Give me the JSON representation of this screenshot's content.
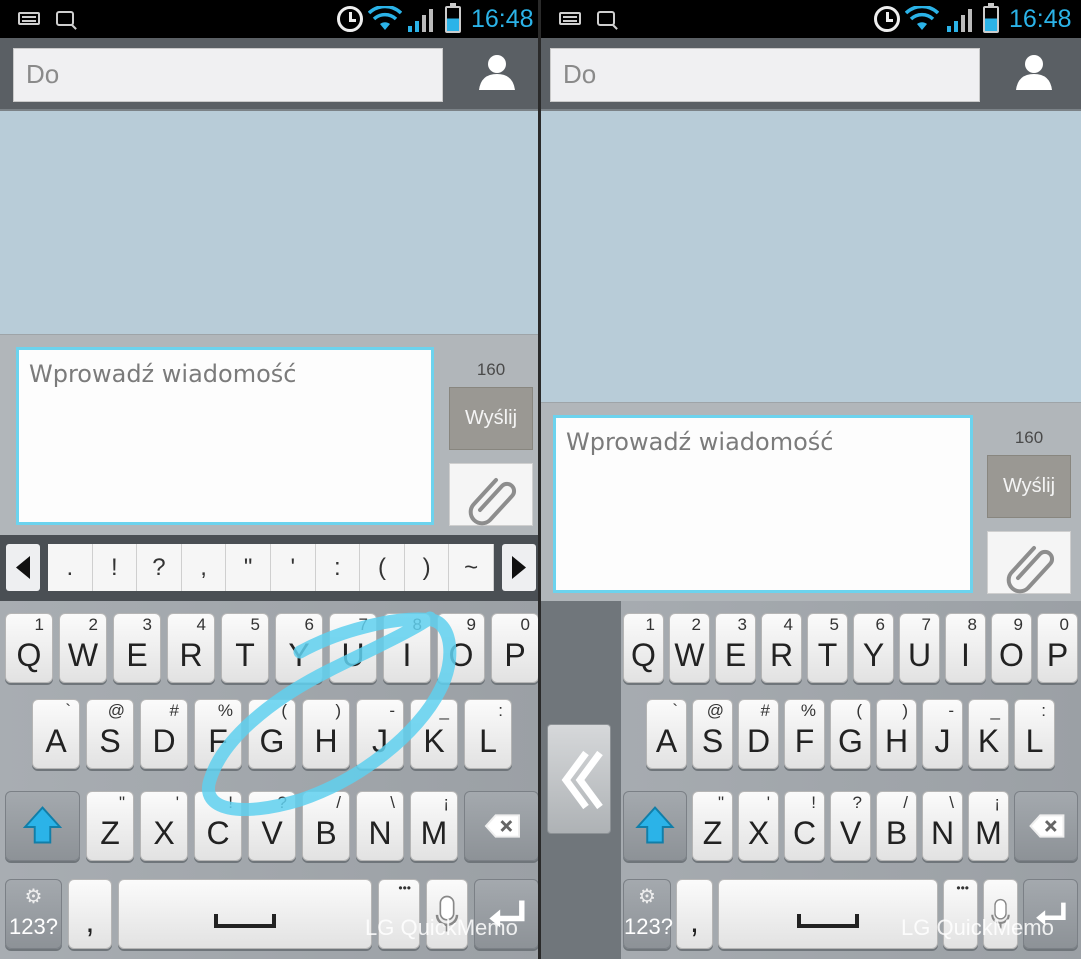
{
  "status_bar": {
    "time": "16:48"
  },
  "recipient": {
    "placeholder": "Do"
  },
  "compose": {
    "placeholder": "Wprowadź wiadomość",
    "counter": "160",
    "send_label": "Wyślij"
  },
  "suggestions": [
    ".",
    "!",
    "?",
    ",",
    "\"",
    "'",
    ":",
    "(",
    ")",
    "~"
  ],
  "keyboard": {
    "row1": [
      {
        "k": "Q",
        "s": "1"
      },
      {
        "k": "W",
        "s": "2"
      },
      {
        "k": "E",
        "s": "3"
      },
      {
        "k": "R",
        "s": "4"
      },
      {
        "k": "T",
        "s": "5"
      },
      {
        "k": "Y",
        "s": "6"
      },
      {
        "k": "U",
        "s": "7"
      },
      {
        "k": "I",
        "s": "8"
      },
      {
        "k": "O",
        "s": "9"
      },
      {
        "k": "P",
        "s": "0"
      }
    ],
    "row2": [
      {
        "k": "A",
        "s": "`"
      },
      {
        "k": "S",
        "s": "@"
      },
      {
        "k": "D",
        "s": "#"
      },
      {
        "k": "F",
        "s": "%"
      },
      {
        "k": "G",
        "s": "("
      },
      {
        "k": "H",
        "s": ")"
      },
      {
        "k": "J",
        "s": "-"
      },
      {
        "k": "K",
        "s": "_"
      },
      {
        "k": "L",
        "s": ":"
      }
    ],
    "row3": [
      {
        "k": "Z",
        "s": "\""
      },
      {
        "k": "X",
        "s": "'"
      },
      {
        "k": "C",
        "s": "!"
      },
      {
        "k": "V",
        "s": "?"
      },
      {
        "k": "B",
        "s": "/"
      },
      {
        "k": "N",
        "s": "\\"
      },
      {
        "k": "M",
        "s": "¡"
      }
    ],
    "symbols_label": "123?",
    "comma": ",",
    "dots_label": "•••"
  },
  "watermark": "LG QuickMemo",
  "colors": {
    "accent": "#2bb3e8",
    "input_border": "#6cd3ee",
    "conversation_bg": "#b8ccd8",
    "scribble": "#5fd0ee"
  }
}
